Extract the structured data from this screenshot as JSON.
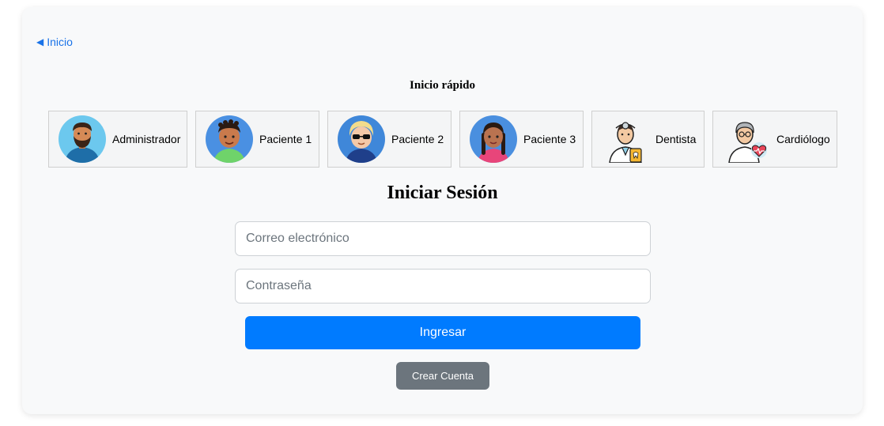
{
  "nav": {
    "back_label": "Inicio"
  },
  "quick_login": {
    "title": "Inicio rápido",
    "profiles": [
      {
        "label": "Administrador",
        "icon": "admin-avatar-icon"
      },
      {
        "label": "Paciente 1",
        "icon": "patient-1-avatar-icon"
      },
      {
        "label": "Paciente 2",
        "icon": "patient-2-avatar-icon"
      },
      {
        "label": "Paciente 3",
        "icon": "patient-3-avatar-icon"
      },
      {
        "label": "Dentista",
        "icon": "dentist-avatar-icon"
      },
      {
        "label": "Cardiólogo",
        "icon": "cardiologist-avatar-icon"
      }
    ]
  },
  "login": {
    "title": "Iniciar Sesión",
    "email_placeholder": "Correo electrónico",
    "email_value": "",
    "password_placeholder": "Contraseña",
    "password_value": "",
    "submit_label": "Ingresar",
    "create_account_label": "Crear Cuenta"
  },
  "colors": {
    "primary": "#007bff",
    "secondary": "#6c757d",
    "link": "#1a73e8",
    "card_bg": "#f8f9fa"
  }
}
